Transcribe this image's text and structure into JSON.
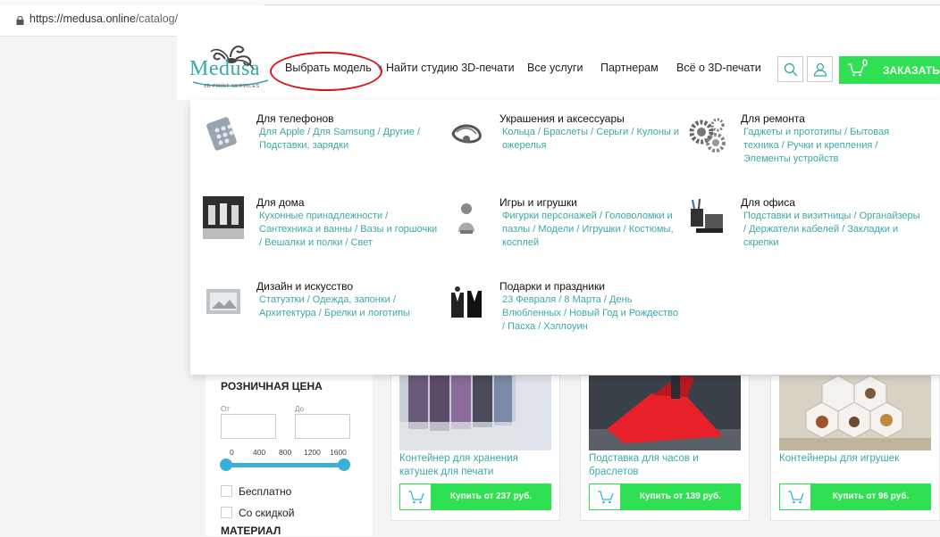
{
  "browser": {
    "url_host": "https://medusa.online",
    "url_path": "/catalog/"
  },
  "header": {
    "logo_text": "Medusa",
    "logo_sub": "3D PRINT SERVICES",
    "nav": [
      {
        "label": "Выбрать модель"
      },
      {
        "label": "Найти студию 3D-печати"
      },
      {
        "label": "Все услуги"
      },
      {
        "label": "Партнерам"
      },
      {
        "label": "Всё о 3D-печати"
      }
    ],
    "cart_count": "0",
    "order_label": "ЗАКАЗАТЬ"
  },
  "menu": [
    {
      "title": "Для телефонов",
      "links": "Для Apple  /  Для Samsung  /  Другие  /  Подставки, зарядки"
    },
    {
      "title": "Украшения и аксессуары",
      "links": "Кольца  /  Браслеты  /  Серьги  /  Кулоны и ожерелья"
    },
    {
      "title": "Для ремонта",
      "links": "Гаджеты и прототипы  /  Бытовая техника  /  Ручки и крепления  /  Элементы устройств"
    },
    {
      "title": "Для дома",
      "links": "Кухонные принадлежности  /  Сантехника и ванны  /  Вазы и горшочки  /  Вешалки и полки  /  Свет"
    },
    {
      "title": "Игры и игрушки",
      "links": "Фигурки персонажей  /  Головоломки и пазлы  /  Модели  /  Игрушки  /  Костюмы, косплей"
    },
    {
      "title": "Для офиса",
      "links": "Подставки и визитницы  /  Органайзеры  /  Держатели кабелей  /  Закладки и скрепки"
    },
    {
      "title": "Дизайн и искусство",
      "links": "Статуэтки  /  Одежда, запонки  /  Архитектура  /  Брелки и логотипы"
    },
    {
      "title": "Подарки и праздники",
      "links": "23 Февраля  /  8 Марта  /  День Влюбленных  /  Новый Год и Рождество  /  Пасха  /  Хэллоуин"
    }
  ],
  "filter": {
    "price_title": "РОЗНИЧНАЯ ЦЕНА",
    "from_label": "От",
    "to_label": "До",
    "ticks": [
      "0",
      "400",
      "800",
      "1200",
      "1600"
    ],
    "range": [
      0,
      1600
    ],
    "options": [
      "Бесплатно",
      "Со скидкой"
    ],
    "material_title": "МАТЕРИАЛ"
  },
  "products": [
    {
      "title": "Контейнер для хранения катушек для печати",
      "buy": "Купить от 237 руб."
    },
    {
      "title": "Подставка для часов и браслетов",
      "buy": "Купить от 139 руб."
    },
    {
      "title": "Контейнеры для игрушек",
      "buy": "Купить от 96 руб."
    }
  ],
  "colors": {
    "accent": "#3aa9a8",
    "green": "#2fe052",
    "highlight": "#d9141a"
  }
}
